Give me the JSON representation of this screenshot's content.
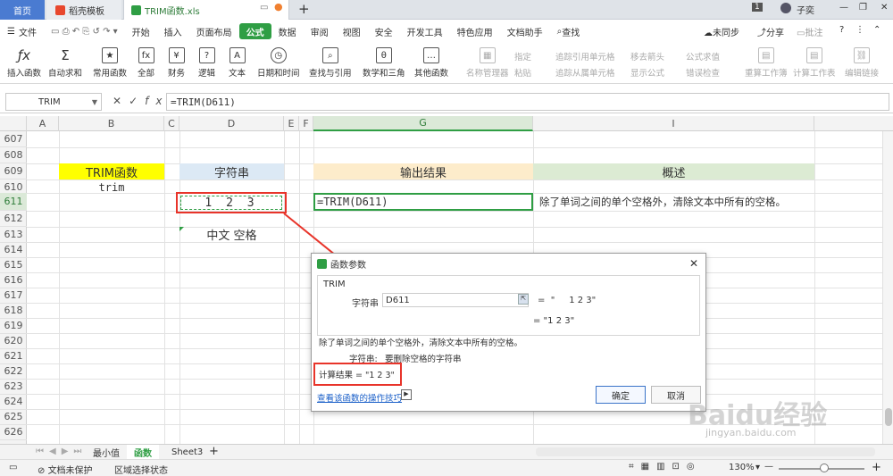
{
  "tabs": {
    "home": "首页",
    "daoke": "稻壳模板",
    "file": "TRIM函数.xls",
    "right_count": "1",
    "user": "子奕"
  },
  "menubar": {
    "file_menu": "文件",
    "items": [
      "开始",
      "插入",
      "页面布局",
      "公式",
      "数据",
      "审阅",
      "视图",
      "安全",
      "开发工具",
      "特色应用",
      "文档助手"
    ],
    "search": "查找",
    "right": [
      "未同步",
      "分享",
      "批注"
    ]
  },
  "toolbar": {
    "buttons": [
      "插入函数",
      "自动求和",
      "常用函数",
      "全部",
      "财务",
      "逻辑",
      "文本",
      "日期和时间",
      "查找与引用",
      "数学和三角",
      "其他函数",
      "名称管理器"
    ],
    "small": [
      "指定",
      "粘贴",
      "追踪引用单元格",
      "追踪从属单元格",
      "移去箭头",
      "显示公式",
      "公式求值",
      "错误检查",
      "重算工作簿",
      "计算工作表",
      "编辑链接"
    ]
  },
  "formula_bar": {
    "name_box": "TRIM",
    "fx": "fx",
    "formula": "=TRIM(D611)"
  },
  "columns": [
    "A",
    "B",
    "C",
    "D",
    "E",
    "F",
    "G",
    "I"
  ],
  "rows": [
    "607",
    "608",
    "609",
    "610",
    "611",
    "612",
    "613",
    "614",
    "615",
    "616",
    "617",
    "618",
    "619",
    "620",
    "621",
    "622",
    "623",
    "624",
    "625",
    "626"
  ],
  "cells": {
    "b609": "TRIM函数",
    "b610": "trim",
    "d609": "字符串",
    "d611": "1 2 3",
    "d613": "中文 空格",
    "g609": "输出结果",
    "g611": "=TRIM(D611)",
    "i609": "概述",
    "i611": "除了单词之间的单个空格外，清除文本中所有的空格。"
  },
  "dialog": {
    "title": "函数参数",
    "func": "TRIM",
    "arg_label": "字符串",
    "arg_value": "D611",
    "arg_result": "=  \"     1 2 3\"",
    "result_line": "=  \"1 2 3\"",
    "description": "除了单词之间的单个空格外，清除文本中所有的空格。",
    "arg_desc_label": "字符串:",
    "arg_desc": "要删除空格的字符串",
    "calc_result": "计算结果  =  \"1 2 3\"",
    "help_link": "查看该函数的操作技巧",
    "ok": "确定",
    "cancel": "取消"
  },
  "sheets": [
    "最小值",
    "函数",
    "Sheet3"
  ],
  "status": {
    "doc_protect": "文档未保护",
    "area": "区域选择状态",
    "zoom": "130%"
  },
  "watermark": {
    "brand": "Baidu经验",
    "url": "jingyan.baidu.com"
  },
  "colors": {
    "accent": "#2f9e44",
    "highlight_red": "#e8342a",
    "yellow": "#ffff00",
    "blue_fill": "#dce9f5",
    "orange_fill": "#fdeccb",
    "green_fill": "#dcebd3"
  }
}
